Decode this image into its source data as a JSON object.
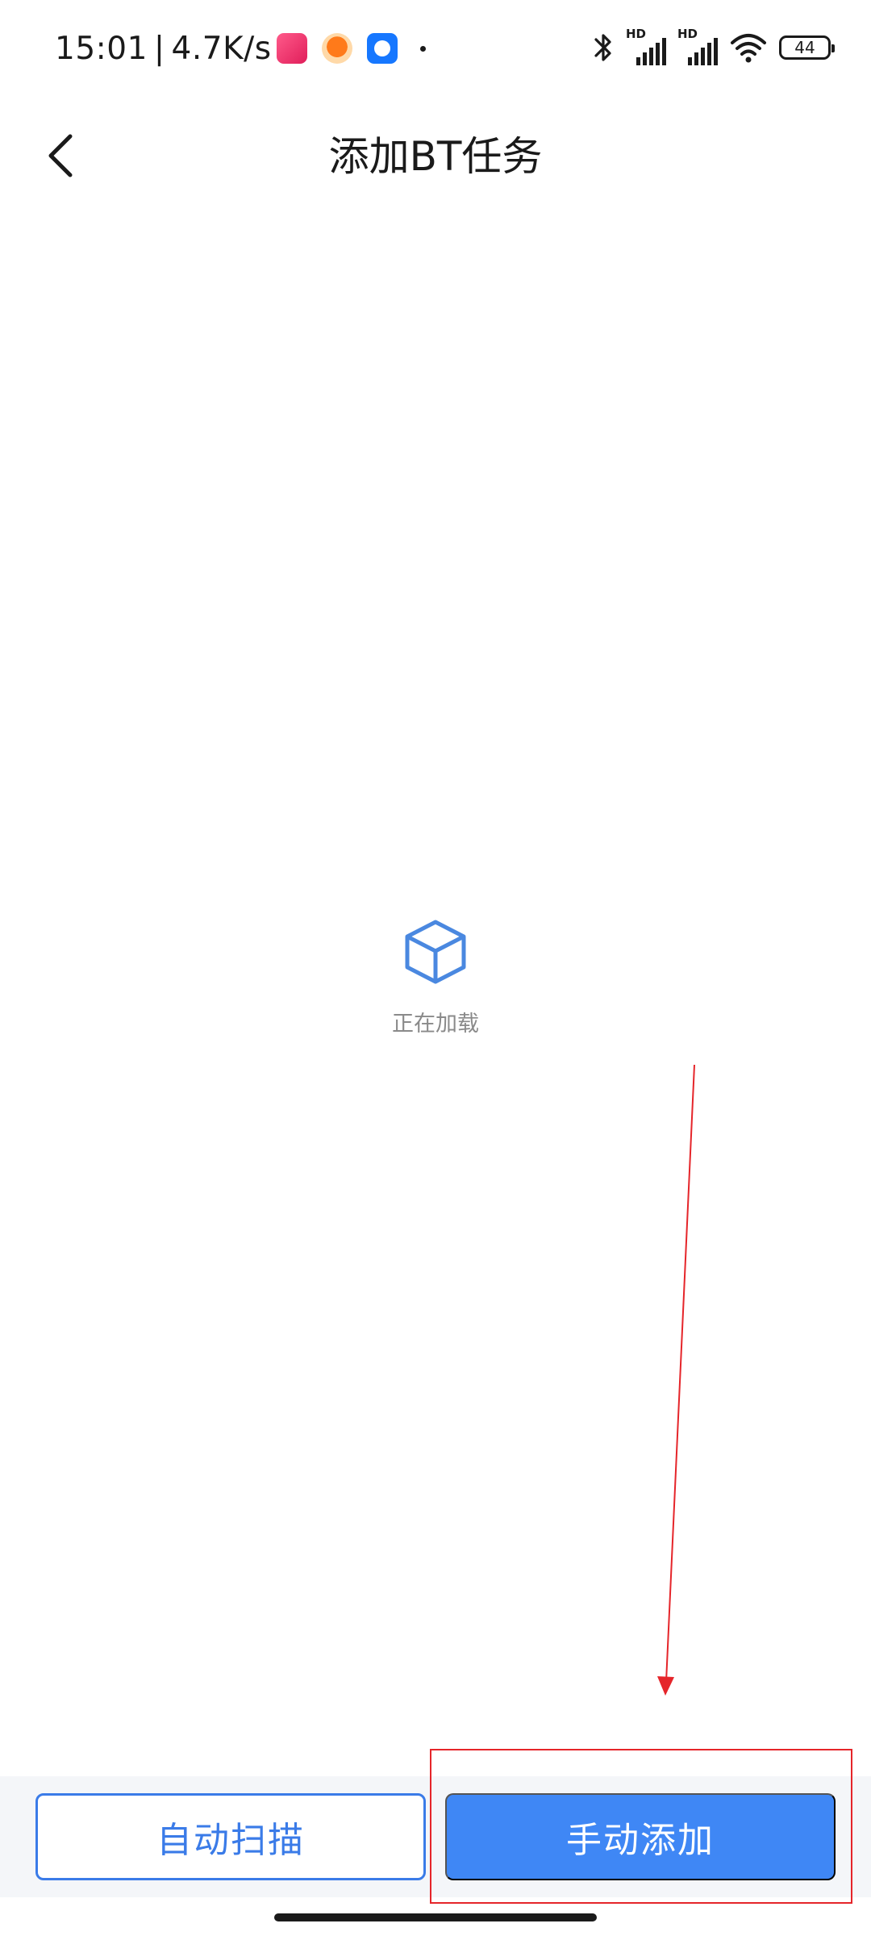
{
  "status_bar": {
    "time": "15:01",
    "separator": "|",
    "net_speed": "4.7K/s",
    "battery_level": "44",
    "signal_1_label": "HD",
    "signal_2_label": "HD"
  },
  "header": {
    "title": "添加BT任务"
  },
  "loading": {
    "text": "正在加载"
  },
  "actions": {
    "auto_scan_label": "自动扫描",
    "manual_add_label": "手动添加"
  },
  "colors": {
    "accent": "#3f87f5",
    "annotation": "#e5252a"
  }
}
